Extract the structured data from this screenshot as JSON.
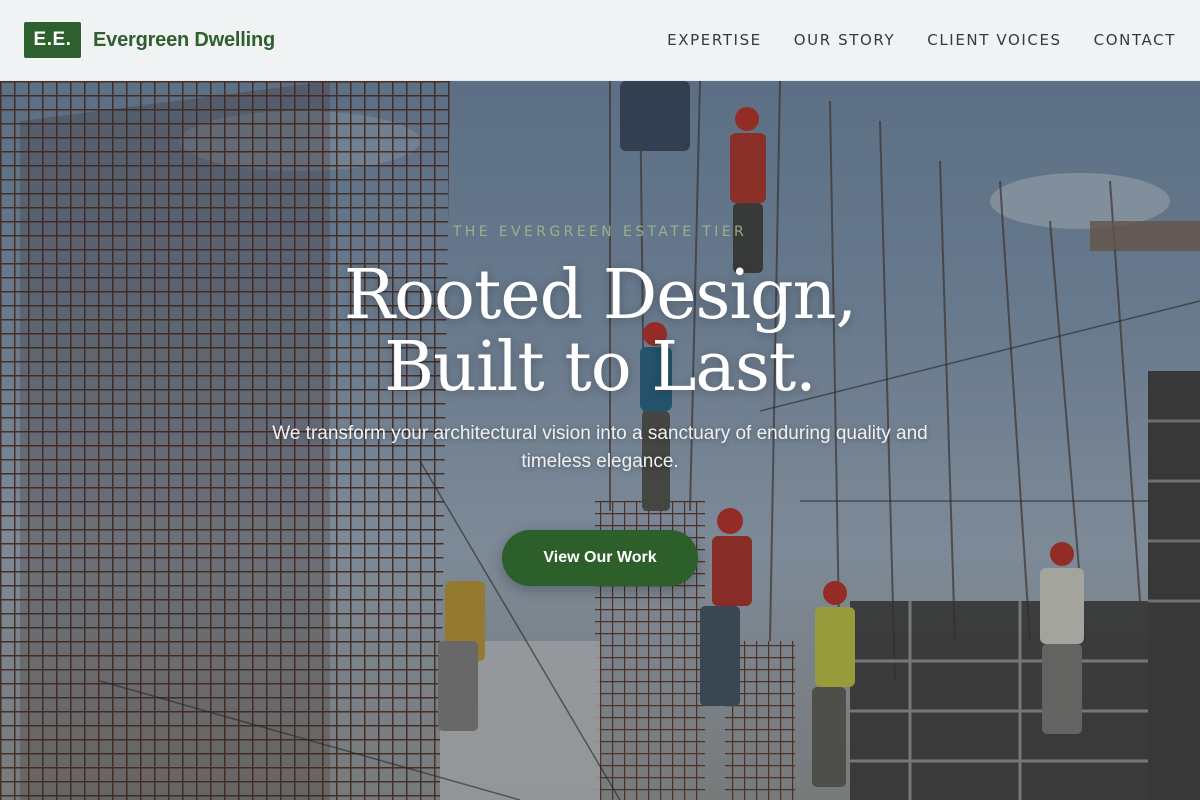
{
  "brand": {
    "logo_text": "E.E.",
    "name": "Evergreen Dwelling",
    "color": "#2e5f2e"
  },
  "nav": {
    "items": [
      {
        "label": "EXPERTISE"
      },
      {
        "label": "OUR STORY"
      },
      {
        "label": "CLIENT VOICES"
      },
      {
        "label": "CONTACT"
      }
    ]
  },
  "hero": {
    "eyebrow": "THE EVERGREEN ESTATE TIER",
    "headline_line1": "Rooted Design,",
    "headline_line2": "Built to Last.",
    "subhead": "We transform your architectural vision into a sanctuary of enduring quality and timeless elegance.",
    "cta_label": "View Our Work",
    "background_image": "construction-workers-on-rebar-scaffolding",
    "accent_color": "#2d5f2a"
  }
}
